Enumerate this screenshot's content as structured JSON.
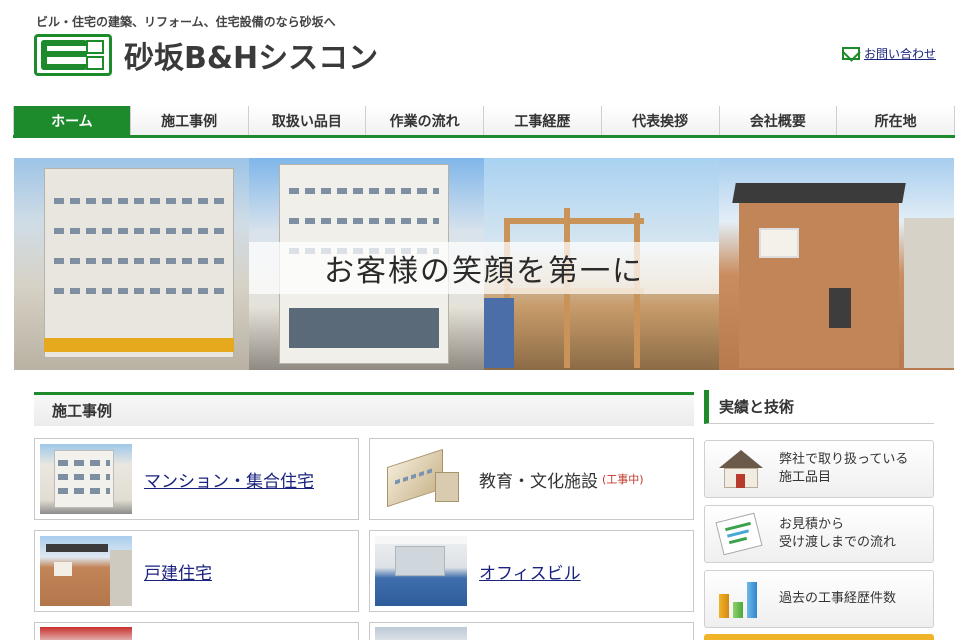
{
  "header": {
    "tagline": "ビル・住宅の建築、リフォーム、住宅設備のなら砂坂へ",
    "logo_text": "砂坂B&Hシスコン",
    "contact_label": "お問い合わせ"
  },
  "nav": {
    "items": [
      "ホーム",
      "施工事例",
      "取扱い品目",
      "作業の流れ",
      "工事経歴",
      "代表挨拶",
      "会社概要",
      "所在地"
    ]
  },
  "hero": {
    "caption": "お客様の笑顔を第一に"
  },
  "works": {
    "title": "施工事例",
    "cards": [
      {
        "label": "マンション・集合住宅",
        "note": ""
      },
      {
        "label": "教育・文化施設",
        "note": "(工事中)"
      },
      {
        "label": "戸建住宅",
        "note": ""
      },
      {
        "label": "オフィスビル",
        "note": ""
      }
    ]
  },
  "sidebar": {
    "title": "実績と技術",
    "items": [
      {
        "line1": "弊社で取り扱っている",
        "line2": "施工品目"
      },
      {
        "line1": "お見積から",
        "line2": "受け渡しまでの流れ"
      },
      {
        "line1": "過去の工事経歴件数",
        "line2": ""
      }
    ]
  },
  "colors": {
    "brand_green": "#1d8a2c",
    "link": "#1a237e",
    "note_red": "#c0392b"
  }
}
